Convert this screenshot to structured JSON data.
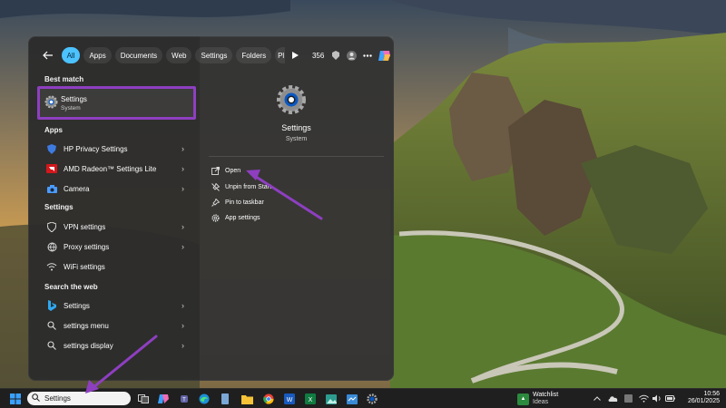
{
  "filter_bar": {
    "chips": [
      "All",
      "Apps",
      "Documents",
      "Web",
      "Settings",
      "Folders",
      "Pl"
    ],
    "points": "356"
  },
  "left": {
    "best_match_title": "Best match",
    "best_match": {
      "name": "Settings",
      "sub": "System"
    },
    "apps_title": "Apps",
    "apps": [
      "HP Privacy Settings",
      "AMD Radeon™ Settings Lite",
      "Camera"
    ],
    "settings_title": "Settings",
    "settings": [
      "VPN settings",
      "Proxy settings",
      "WiFi settings"
    ],
    "web_title": "Search the web",
    "web": [
      "Settings",
      "settings menu",
      "settings display"
    ]
  },
  "preview": {
    "title": "Settings",
    "subtitle": "System",
    "actions": [
      "Open",
      "Unpin from Start",
      "Pin to taskbar",
      "App settings"
    ]
  },
  "taskbar": {
    "search_value": "Settings",
    "weather_title": "Watchlist",
    "weather_sub": "Ideas",
    "time": "10:56",
    "date": "26/01/2025"
  },
  "colors": {
    "accent": "#4cc2ff",
    "highlight_frame": "#8e3fc0",
    "annotation_arrow": "#8e3fc0",
    "panel_bg": "#2c2c2c",
    "taskbar_bg": "#1f1f1f"
  }
}
